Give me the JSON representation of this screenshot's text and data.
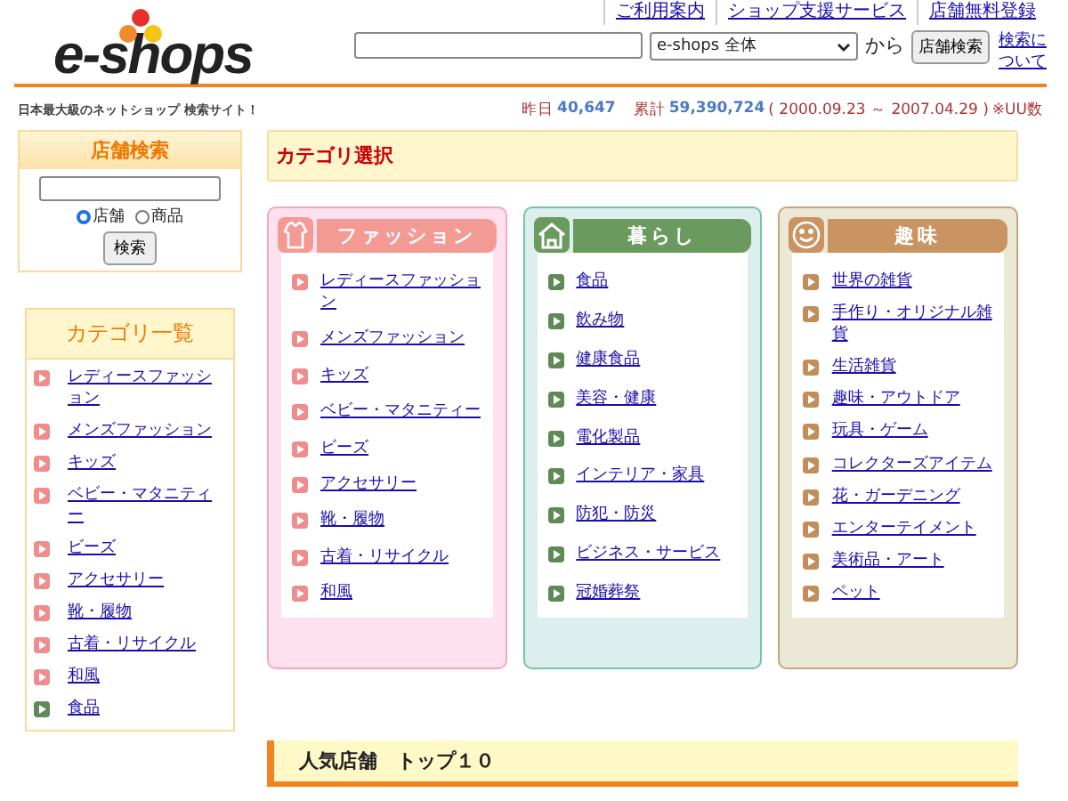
{
  "header": {
    "logo": "e-shops",
    "links": [
      "ご利用案内",
      "ショップ支援サービス",
      "店舗無料登録"
    ],
    "search": {
      "scope": "e-shops 全体",
      "from_label": "から",
      "button": "店舗検索",
      "help_link": "検索について"
    }
  },
  "tagline": "日本最大級のネットショップ 検索サイト！",
  "stats": {
    "yesterday_label": "昨日",
    "yesterday": "40,647",
    "total_label": "累計",
    "total": "59,390,724",
    "period": "( 2000.09.23 ～ 2007.04.29 )",
    "note": "※UU数"
  },
  "shop_search": {
    "title": "店舗検索",
    "options": [
      {
        "label": "店舗",
        "selected": true
      },
      {
        "label": "商品",
        "selected": false
      }
    ],
    "button": "検索"
  },
  "category_list": {
    "title": "カテゴリ一覧",
    "items": [
      {
        "label": "レディースファッション",
        "color": "#f08c8c"
      },
      {
        "label": "メンズファッション",
        "color": "#f08c8c"
      },
      {
        "label": "キッズ",
        "color": "#f08c8c"
      },
      {
        "label": "ベビー・マタニティー",
        "color": "#f08c8c"
      },
      {
        "label": "ビーズ",
        "color": "#f08c8c"
      },
      {
        "label": "アクセサリー",
        "color": "#f08c8c"
      },
      {
        "label": "靴・履物",
        "color": "#f08c8c"
      },
      {
        "label": "古着・リサイクル",
        "color": "#f08c8c"
      },
      {
        "label": "和風",
        "color": "#f08c8c"
      },
      {
        "label": "食品",
        "color": "#5e8a55"
      }
    ]
  },
  "category_select": {
    "title": "カテゴリ選択",
    "groups": [
      {
        "kind": "fashion",
        "title": "ファッション",
        "items": [
          "レディースファッション",
          "メンズファッション",
          "キッズ",
          "ベビー・マタニティー",
          "ビーズ",
          "アクセサリー",
          "靴・履物",
          "古着・リサイクル",
          "和風"
        ]
      },
      {
        "kind": "living",
        "title": "暮らし",
        "items": [
          "食品",
          "飲み物",
          "健康食品",
          "美容・健康",
          "電化製品",
          "インテリア・家具",
          "防犯・防災",
          "ビジネス・サービス",
          "冠婚葬祭"
        ]
      },
      {
        "kind": "hobby",
        "title": "趣味",
        "items": [
          "世界の雑貨",
          "手作り・オリジナル雑貨",
          "生活雑貨",
          "趣味・アウトドア",
          "玩具・ゲーム",
          "コレクターズアイテム",
          "花・ガーデニング",
          "エンターテイメント",
          "美術品・アート",
          "ペット"
        ]
      }
    ]
  },
  "ranking": {
    "title": "人気店舗　トップ１０"
  }
}
